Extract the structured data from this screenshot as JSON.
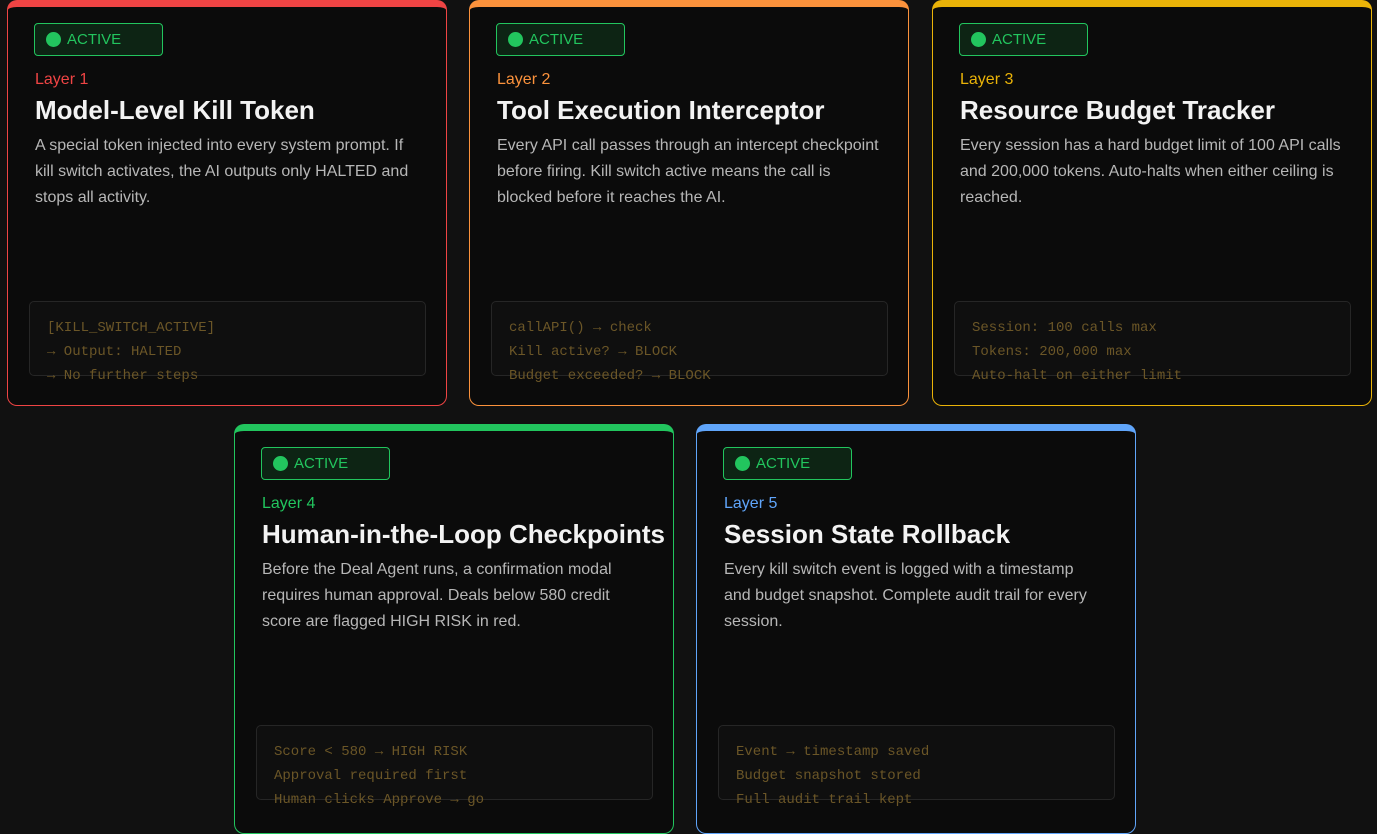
{
  "cards": [
    {
      "status": "ACTIVE",
      "layer": "Layer 1",
      "title": "Model-Level Kill Token",
      "description": "A special token injected into every system prompt. If kill switch activates, the AI outputs only HALTED and stops all activity.",
      "code": [
        "[KILL_SWITCH_ACTIVE]",
        "→ Output: HALTED",
        "→ No further steps"
      ],
      "accent": "#ef4444"
    },
    {
      "status": "ACTIVE",
      "layer": "Layer 2",
      "title": "Tool Execution Interceptor",
      "description": "Every API call passes through an intercept checkpoint before firing. Kill switch active means the call is blocked before it reaches the AI.",
      "code": [
        "callAPI() → check",
        "Kill active? → BLOCK",
        "Budget exceeded? → BLOCK"
      ],
      "accent": "#fb923c"
    },
    {
      "status": "ACTIVE",
      "layer": "Layer 3",
      "title": "Resource Budget Tracker",
      "description": "Every session has a hard budget limit of 100 API calls and 200,000 tokens. Auto-halts when either ceiling is reached.",
      "code": [
        "Session: 100 calls max",
        "Tokens: 200,000 max",
        "Auto-halt on either limit"
      ],
      "accent": "#eab308"
    },
    {
      "status": "ACTIVE",
      "layer": "Layer 4",
      "title": "Human-in-the-Loop Checkpoints",
      "description": "Before the Deal Agent runs, a confirmation modal requires human approval. Deals below 580 credit score are flagged HIGH RISK in red.",
      "code": [
        "Score < 580 → HIGH RISK",
        "Approval required first",
        "Human clicks Approve → go"
      ],
      "accent": "#22c55e"
    },
    {
      "status": "ACTIVE",
      "layer": "Layer 5",
      "title": "Session State Rollback",
      "description": "Every kill switch event is logged with a timestamp and budget snapshot. Complete audit trail for every session.",
      "code": [
        "Event → timestamp saved",
        "Budget snapshot stored",
        "Full audit trail kept"
      ],
      "accent": "#60a5fa"
    }
  ],
  "icons": {
    "status_dot": "status-dot-icon"
  }
}
